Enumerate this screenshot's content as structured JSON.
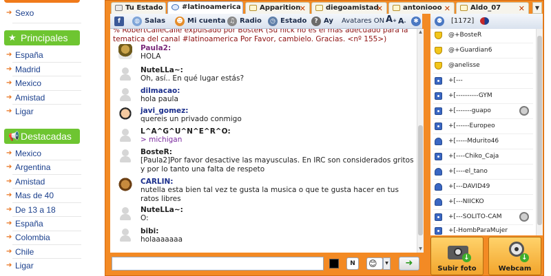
{
  "nav": {
    "top_links": [
      {
        "label": "Sexo"
      }
    ],
    "sections": [
      {
        "title": "Principales",
        "items": [
          {
            "label": "España"
          },
          {
            "label": "Madrid"
          },
          {
            "label": "Mexico"
          },
          {
            "label": "Amistad"
          },
          {
            "label": "Ligar"
          }
        ]
      },
      {
        "title": "Destacadas",
        "items": [
          {
            "label": "Mexico"
          },
          {
            "label": "Argentina"
          },
          {
            "label": "Amistad"
          },
          {
            "label": "Mas de 40"
          },
          {
            "label": "De 13 a 18"
          },
          {
            "label": "España"
          },
          {
            "label": "Colombia"
          },
          {
            "label": "Chile"
          },
          {
            "label": "Ligar"
          }
        ]
      }
    ]
  },
  "tabs": [
    {
      "label": "Tu Estado",
      "icon": "house-icon"
    },
    {
      "label": "#latinoamerica",
      "icon": "chat-bubble-icon",
      "active": true
    },
    {
      "label": "Apparition",
      "icon": "chat-bubble-icon"
    },
    {
      "label": "diegoamistad",
      "icon": "chat-bubble-icon"
    },
    {
      "label": "antoniooo",
      "icon": "chat-bubble-icon"
    },
    {
      "label": "Aldo_07",
      "icon": "chat-bubble-icon"
    }
  ],
  "toolbar": {
    "salas": "Salas",
    "mi_cuenta": "Mi cuenta",
    "radio": "Radio",
    "estado": "Estado",
    "ay": "Ay",
    "avatares": "Avatares ON",
    "font_big": "A",
    "font_small": "A"
  },
  "system_line": {
    "text": "% RobertCalleCalle expulsado por BosteR (Su nick no es el más adecuado para la tematica del canal #latinoamerica Por Favor, cambielo. Gracias. <nº 155>)"
  },
  "messages": [
    {
      "nick": "Paula2:",
      "text": "HOLA",
      "avatar": "picture",
      "nick_color": "#7a2a7a"
    },
    {
      "nick": "NuteLLa~:",
      "text": "Oh, así.. En qué lugar estás?",
      "avatar": "default"
    },
    {
      "nick": "dilmacao:",
      "text": "hola paula",
      "avatar": "default",
      "nick_color": "#1b2f8c"
    },
    {
      "nick": "javi_gomez:",
      "text": "quereis un privado conmigo",
      "avatar": "picture",
      "nick_color": "#1b2f8c"
    },
    {
      "nick": "L^A^G^U^N^E^R^O:",
      "text": "> michigan",
      "avatar": "default",
      "text_color": "#7a2a9e"
    },
    {
      "nick": "BosteR:",
      "text": "[Paula2]Por favor desactive las mayusculas. En IRC son considerados gritos y por lo tanto una falta de respeto",
      "avatar": "default"
    },
    {
      "nick": "CARLIN:",
      "text": "nutella esta bien tal vez te gusta la musica o que te gusta hacer en tus ratos libres",
      "avatar": "picture",
      "nick_color": "#1b2f8c"
    },
    {
      "nick": "NuteLLa~:",
      "text": "O:",
      "avatar": "default"
    },
    {
      "nick": "bibi:",
      "text": "holaaaaaaa",
      "avatar": "default"
    }
  ],
  "input": {
    "placeholder": "",
    "value": "",
    "bold_label": "N"
  },
  "userlist_header": {
    "count": "[1172]"
  },
  "users": [
    {
      "name": "@+BosteR",
      "icon": "shield"
    },
    {
      "name": "@+Guardian6",
      "icon": "shield"
    },
    {
      "name": "@anelisse",
      "icon": "shield"
    },
    {
      "name": "+[---",
      "icon": "cam"
    },
    {
      "name": "+[----------GYM",
      "icon": "cam"
    },
    {
      "name": "+[-------guapo",
      "icon": "cam",
      "webcam": true
    },
    {
      "name": "+[------Europeo",
      "icon": "cam"
    },
    {
      "name": "+[-----Mdurito46",
      "icon": "person"
    },
    {
      "name": "+[----Chiko_Caja",
      "icon": "cam"
    },
    {
      "name": "+[----el_tano",
      "icon": "person"
    },
    {
      "name": "+[---DAVID49",
      "icon": "person"
    },
    {
      "name": "+[---NIICKO",
      "icon": "person"
    },
    {
      "name": "+[---SOLITO-CAM",
      "icon": "cam",
      "webcam": true
    },
    {
      "name": "+[-HombParaMujer",
      "icon": "cam"
    }
  ],
  "buttons": {
    "subir_foto": "Subir foto",
    "webcam": "Webcam"
  },
  "colors": {
    "frame": "#f38a24",
    "nav_header": "#6ec531",
    "link": "#1a3f8c"
  }
}
